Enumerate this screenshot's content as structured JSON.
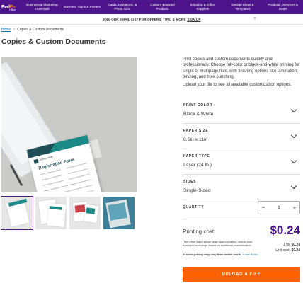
{
  "header": {
    "logo": {
      "fed": "Fed",
      "ex": "Ex",
      "sub": "Office"
    },
    "nav": [
      "Business & Marketing Essentials",
      "Banners, Signs & Posters",
      "Cards, Invitations, & Photo Gifts",
      "Custom Branded Products",
      "Shipping & Office Supplies",
      "Design Ideas & Templates",
      "Products, Services & Deals"
    ]
  },
  "email_banner": {
    "text": "JOIN OUR EMAIL LIST FOR OFFERS, TIPS, & MORE",
    "link": "SIGN UP",
    "close": "×"
  },
  "breadcrumb": {
    "home": "Home",
    "separator": ">",
    "current": "Copies & Custom Documents"
  },
  "page": {
    "title": "Copies & Custom Documents"
  },
  "hero": {
    "doc_title": "Registration Form",
    "doc_brand": "BRAND NAME"
  },
  "description": [
    "Print copies and custom documents quickly and professionally. Choose full-color or black-and-white printing for single or multipage files, with finishing options like lamination, binding, and hole punching.",
    "Upload your file to see all available customization options."
  ],
  "options": [
    {
      "label": "PRINT COLOR",
      "value": "Black & White"
    },
    {
      "label": "PAPER SIZE",
      "value": "8.5in x 11in"
    },
    {
      "label": "PAPER TYPE",
      "value": "Laser (24 lb.)"
    },
    {
      "label": "SIDES",
      "value": "Single-Sided"
    }
  ],
  "quantity": {
    "label": "QUANTITY",
    "value": "1",
    "minus": "−",
    "plus": "+"
  },
  "cost": {
    "label": "Printing cost:",
    "price": "$0.24",
    "per_label": "1 for",
    "per_value": "$0.24",
    "unit_label": "Unit cost:",
    "unit_value": "$0.24",
    "disclaimer": "*The price listed above is an approximation. Actual cost is subject to change based on additional customization.",
    "instore": "In-store pricing may vary from online costs.",
    "learn_more": "Learn More"
  },
  "upload_button": "UPLOAD A FILE",
  "colors": {
    "brand_purple": "#4d148c",
    "brand_orange": "#ff6200",
    "link_blue": "#007ab7"
  }
}
